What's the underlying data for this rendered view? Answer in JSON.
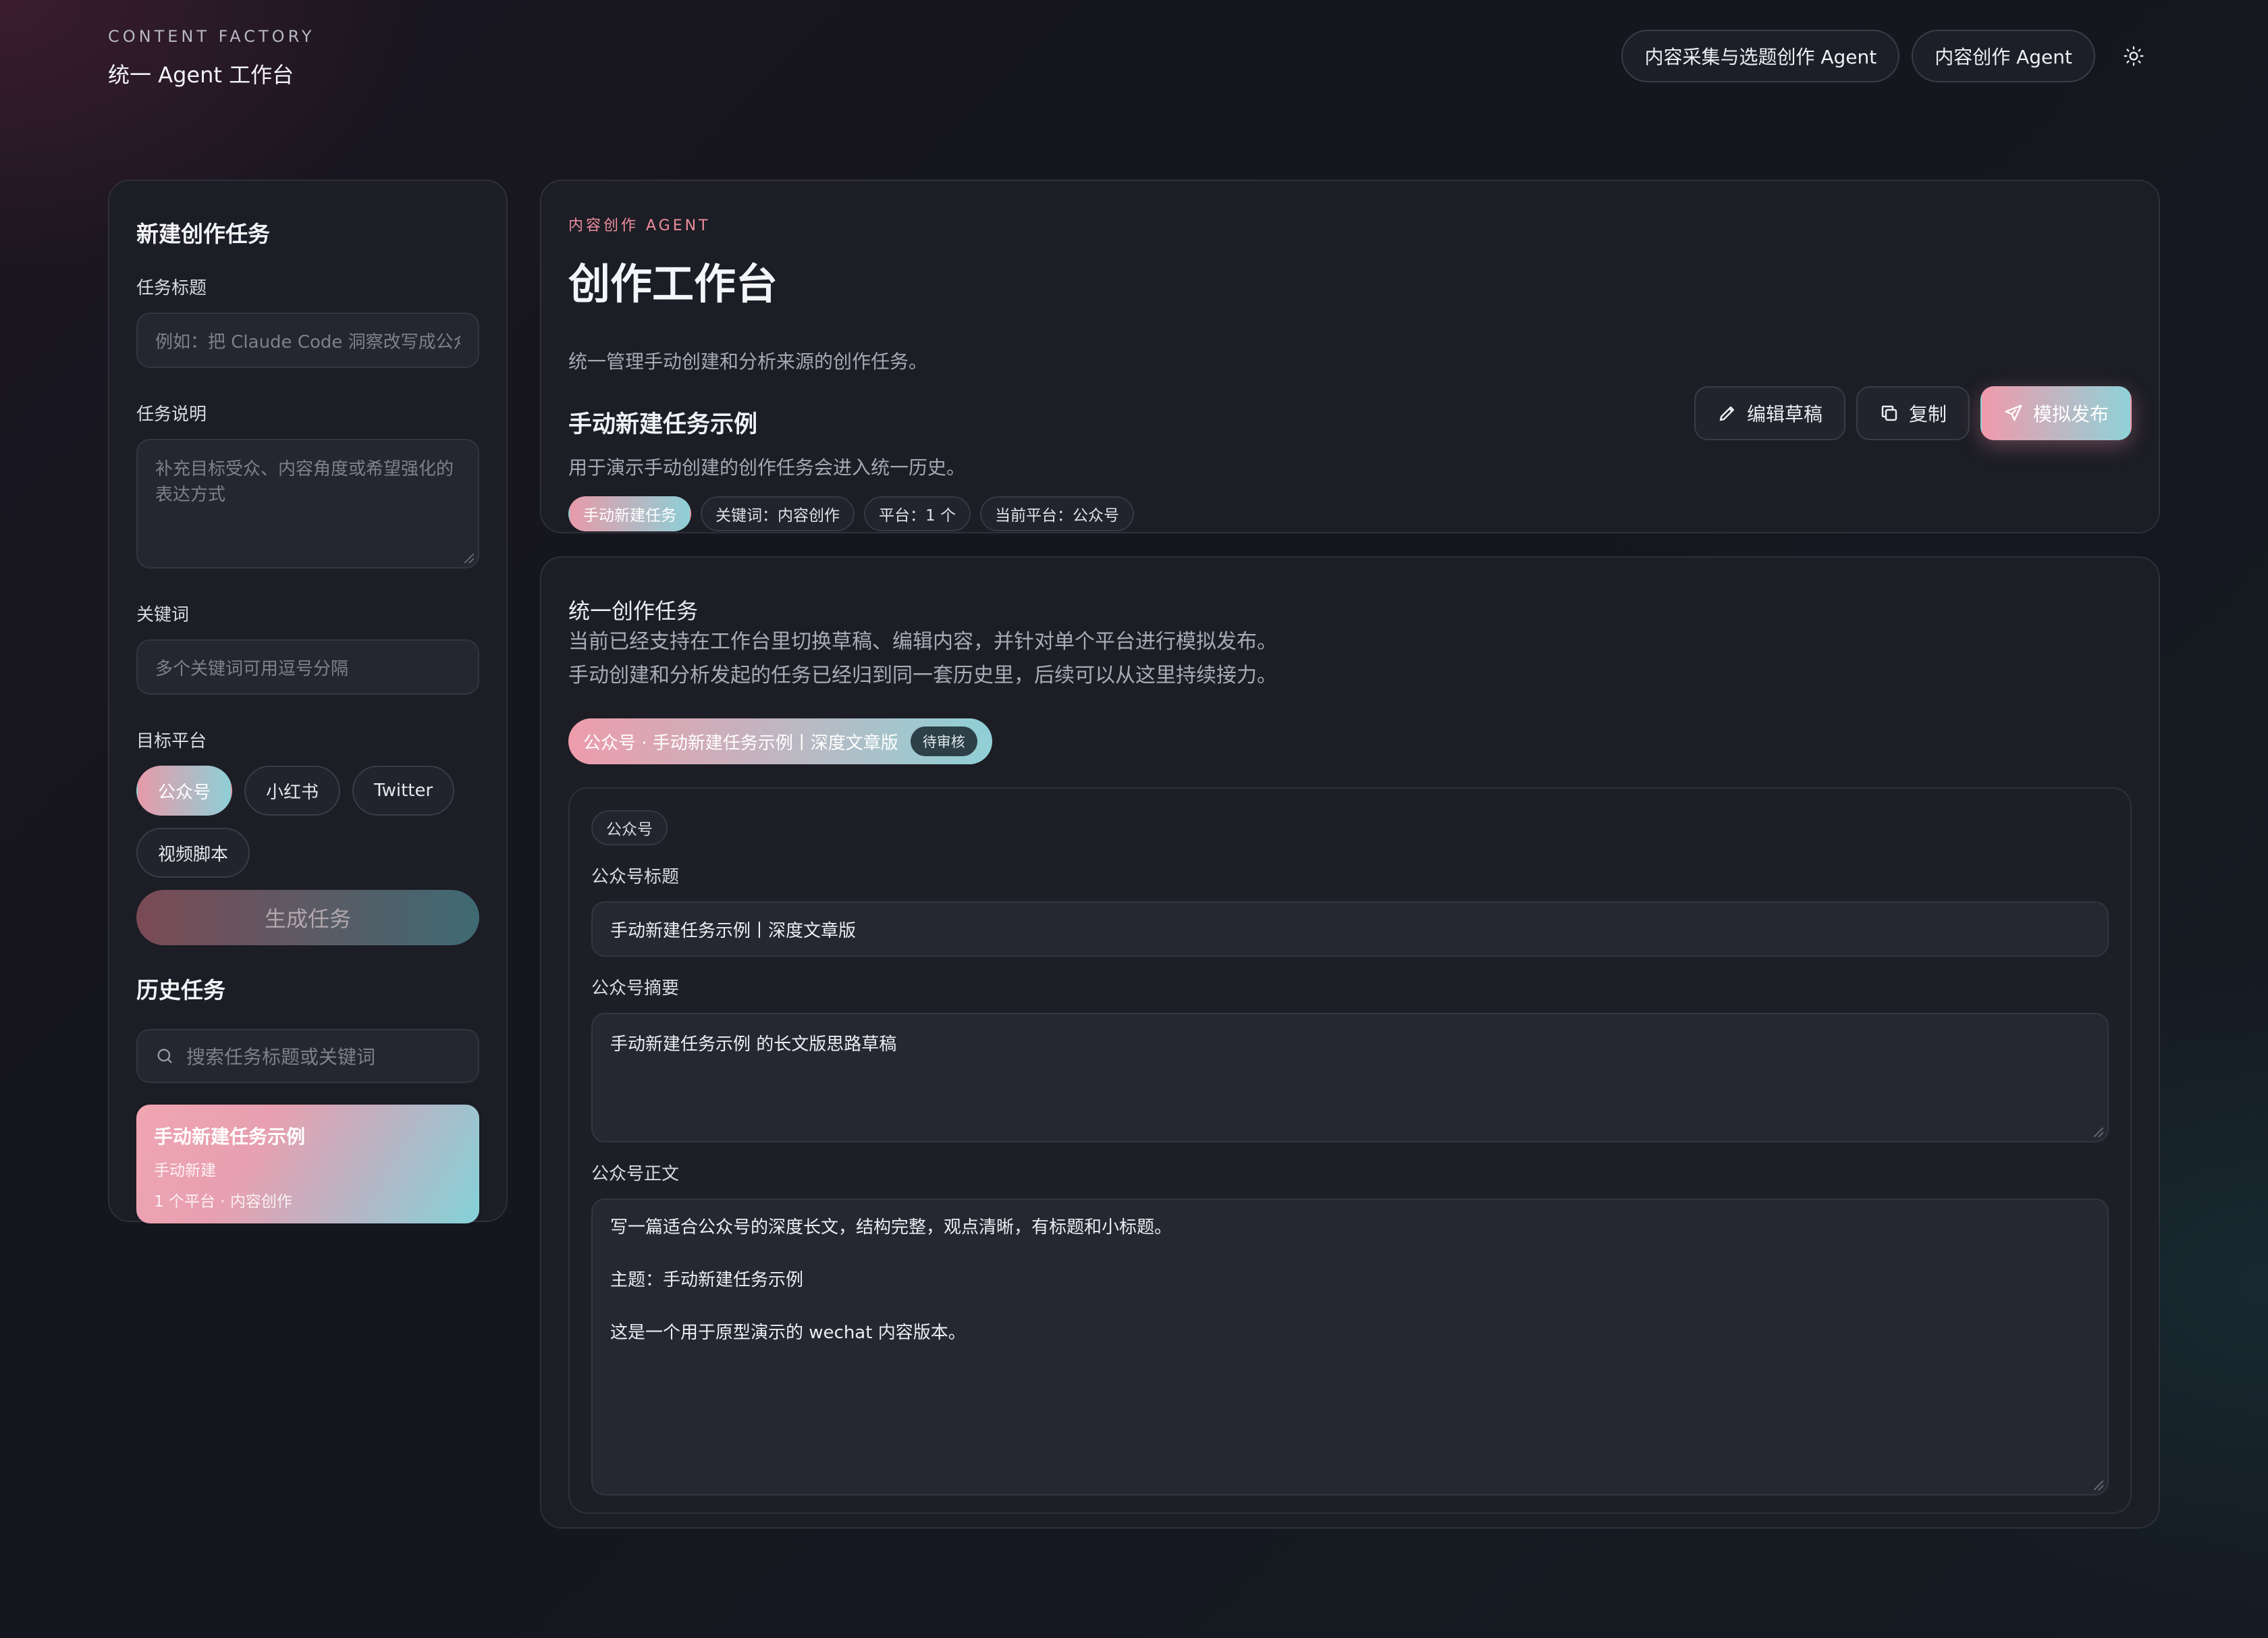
{
  "header": {
    "brand_sub": "CONTENT FACTORY",
    "brand_title": "统一 Agent 工作台",
    "nav": [
      "内容采集与选题创作 Agent",
      "内容创作 Agent"
    ],
    "theme_icon": "sun-icon"
  },
  "left": {
    "new_task_title": "新建创作任务",
    "task_title_label": "任务标题",
    "task_title_placeholder": "例如：把 Claude Code 洞察改写成公众",
    "task_desc_label": "任务说明",
    "task_desc_placeholder": "补充目标受众、内容角度或希望强化的表达方式",
    "keywords_label": "关键词",
    "keywords_placeholder": "多个关键词可用逗号分隔",
    "platform_label": "目标平台",
    "platforms": [
      "公众号",
      "小红书",
      "Twitter",
      "视频脚本"
    ],
    "generate_label": "生成任务",
    "history_title": "历史任务",
    "search_placeholder": "搜索任务标题或关键词",
    "history_items": [
      {
        "title": "手动新建任务示例",
        "source": "手动新建",
        "meta": "1 个平台 · 内容创作"
      }
    ]
  },
  "hero": {
    "eyebrow": "内容创作 AGENT",
    "title": "创作工作台",
    "desc": "统一管理手动创建和分析来源的创作任务。",
    "task_name": "手动新建任务示例",
    "task_desc": "用于演示手动创建的创作任务会进入统一历史。",
    "chips": [
      "手动新建任务",
      "关键词：内容创作",
      "平台：1 个",
      "当前平台：公众号"
    ],
    "actions": {
      "edit": "编辑草稿",
      "copy": "复制",
      "publish": "模拟发布"
    }
  },
  "work": {
    "title": "统一创作任务",
    "desc_line1": "当前已经支持在工作台里切换草稿、编辑内容，并针对单个平台进行模拟发布。",
    "desc_line2": "手动创建和分析发起的任务已经归到同一套历史里，后续可以从这里持续接力。",
    "draft_tab": "公众号 · 手动新建任务示例丨深度文章版",
    "draft_status": "待审核",
    "platform_tag": "公众号",
    "title_label": "公众号标题",
    "title_value": "手动新建任务示例丨深度文章版",
    "summary_label": "公众号摘要",
    "summary_value": "手动新建任务示例 的长文版思路草稿",
    "body_label": "公众号正文",
    "body_value": "写一篇适合公众号的深度长文，结构完整，观点清晰，有标题和小标题。\n\n主题：手动新建任务示例\n\n这是一个用于原型演示的 wechat 内容版本。"
  },
  "colors": {
    "accent_pink": "#ee9cab",
    "accent_teal": "#8fd0d6",
    "eyebrow": "#ee8e9e"
  }
}
